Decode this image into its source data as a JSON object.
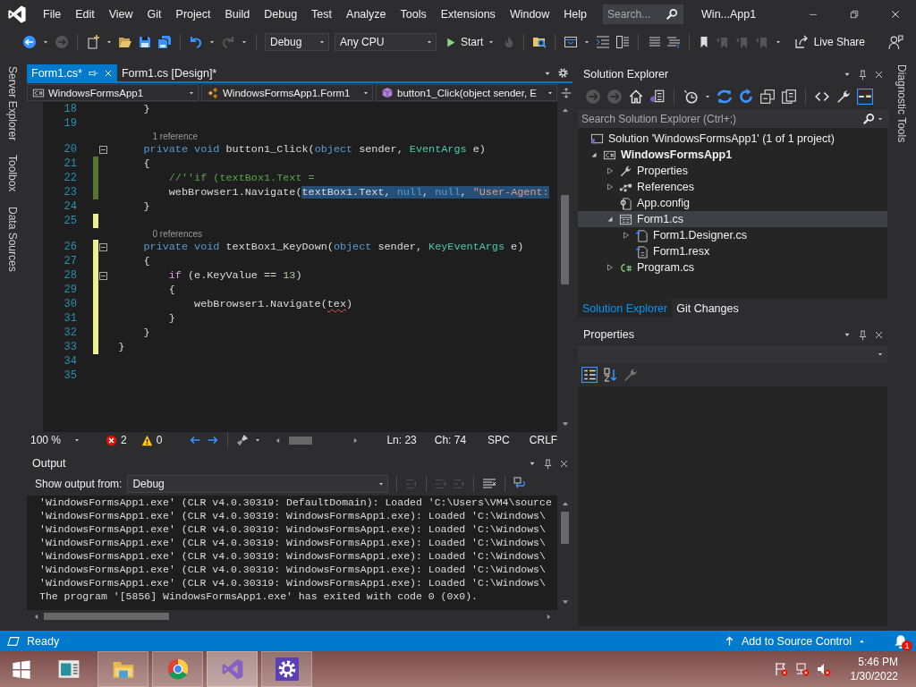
{
  "title_bar": {
    "menus": [
      "File",
      "Edit",
      "View",
      "Git",
      "Project",
      "Build",
      "Debug",
      "Test",
      "Analyze",
      "Tools",
      "Extensions",
      "Window",
      "Help"
    ],
    "search": {
      "placeholder": "Search..."
    },
    "title": "Win...App1"
  },
  "toolbar": {
    "configuration": "Debug",
    "platform": "Any CPU",
    "start": "Start",
    "live_share": "Live Share"
  },
  "left_tool_tabs": [
    "Server Explorer",
    "Toolbox",
    "Data Sources"
  ],
  "editor": {
    "tabs": [
      {
        "label": "Form1.cs*",
        "selected": true
      },
      {
        "label": "Form1.cs [Design]*",
        "selected": false
      }
    ],
    "nav": [
      {
        "kind": "project",
        "label": "WindowsFormsApp1"
      },
      {
        "kind": "class",
        "label": "WindowsFormsApp1.Form1"
      },
      {
        "kind": "method",
        "label": "button1_Click(object sender, E"
      }
    ],
    "lines": [
      {
        "number": "18",
        "changed": false,
        "tokens": [
          {
            "kind": "plain",
            "text": "      }"
          }
        ]
      },
      {
        "number": "19",
        "changed": false
      },
      {
        "number": "20",
        "changed": false,
        "lens": "1 reference",
        "fold": true,
        "tokens": [
          {
            "kind": "keyword",
            "text": "      private"
          },
          {
            "kind": "keyword",
            "text": " void"
          },
          {
            "kind": "plain",
            "text": " button1_Click("
          },
          {
            "kind": "keyword",
            "text": "object"
          },
          {
            "kind": "plain",
            "text": " sender, "
          },
          {
            "kind": "type",
            "text": "EventArgs"
          },
          {
            "kind": "plain",
            "text": " e)"
          }
        ]
      },
      {
        "number": "21",
        "changed": true,
        "saved": true,
        "tokens": [
          {
            "kind": "plain",
            "text": "      {"
          }
        ]
      },
      {
        "number": "22",
        "changed": true,
        "saved": true,
        "tokens": [
          {
            "kind": "comment",
            "text": "          //''if (textBox1.Text ="
          }
        ]
      },
      {
        "number": "23",
        "changed": true,
        "saved": true,
        "tokens": [
          {
            "kind": "plain",
            "text": "          webBrowser1.Navigate("
          },
          {
            "kind": "plain",
            "text": "textBox1.Text, ",
            "selected": true
          },
          {
            "kind": "keyword",
            "text": "null",
            "selected": true
          },
          {
            "kind": "plain",
            "text": ", ",
            "selected": true
          },
          {
            "kind": "keyword",
            "text": "null",
            "selected": true
          },
          {
            "kind": "plain",
            "text": ", ",
            "selected": true
          },
          {
            "kind": "string",
            "text": "\"User-Agent:",
            "selected": true
          }
        ]
      },
      {
        "number": "24",
        "changed": false,
        "tokens": [
          {
            "kind": "plain",
            "text": "      }"
          }
        ]
      },
      {
        "number": "25",
        "changed": true,
        "saved": false
      },
      {
        "number": "26",
        "changed": true,
        "saved": false,
        "lens": "0 references",
        "fold": true,
        "tokens": [
          {
            "kind": "keyword",
            "text": "      private"
          },
          {
            "kind": "keyword",
            "text": " void"
          },
          {
            "kind": "plain",
            "text": " textBox1_KeyDown("
          },
          {
            "kind": "keyword",
            "text": "object"
          },
          {
            "kind": "plain",
            "text": " sender, "
          },
          {
            "kind": "type",
            "text": "KeyEventArgs"
          },
          {
            "kind": "plain",
            "text": " e)"
          }
        ]
      },
      {
        "number": "27",
        "changed": true,
        "saved": false,
        "tokens": [
          {
            "kind": "plain",
            "text": "      {"
          }
        ]
      },
      {
        "number": "28",
        "changed": true,
        "saved": false,
        "fold": true,
        "tokens": [
          {
            "kind": "control",
            "text": "          if"
          },
          {
            "kind": "plain",
            "text": " (e.KeyValue == "
          },
          {
            "kind": "number",
            "text": "13"
          },
          {
            "kind": "plain",
            "text": ")"
          }
        ]
      },
      {
        "number": "29",
        "changed": true,
        "saved": false,
        "tokens": [
          {
            "kind": "plain",
            "text": "          {"
          }
        ]
      },
      {
        "number": "30",
        "changed": true,
        "saved": false,
        "tokens": [
          {
            "kind": "plain",
            "text": "              webBrowser1.Navigate("
          },
          {
            "kind": "plain",
            "text": "tex",
            "error": true
          },
          {
            "kind": "plain",
            "text": ")"
          }
        ]
      },
      {
        "number": "31",
        "changed": true,
        "saved": false,
        "tokens": [
          {
            "kind": "plain",
            "text": "          }"
          }
        ]
      },
      {
        "number": "32",
        "changed": true,
        "saved": false,
        "tokens": [
          {
            "kind": "plain",
            "text": "      }"
          }
        ]
      },
      {
        "number": "33",
        "changed": true,
        "saved": false,
        "tokens": [
          {
            "kind": "plain",
            "text": "  }"
          }
        ]
      },
      {
        "number": "34",
        "changed": false
      },
      {
        "number": "35",
        "changed": false
      }
    ],
    "status": {
      "zoom": "100 %",
      "errors": "2",
      "warnings": "0",
      "line": "Ln: 23",
      "column": "Ch: 74",
      "whitespace": "SPC",
      "line_ending": "CRLF"
    }
  },
  "output": {
    "title": "Output",
    "source_label": "Show output from:",
    "source": "Debug",
    "lines": [
      "'WindowsFormsApp1.exe' (CLR v4.0.30319: DefaultDomain): Loaded 'C:\\Users\\VM4\\source",
      "'WindowsFormsApp1.exe' (CLR v4.0.30319: WindowsFormsApp1.exe): Loaded 'C:\\Windows\\",
      "'WindowsFormsApp1.exe' (CLR v4.0.30319: WindowsFormsApp1.exe): Loaded 'C:\\Windows\\",
      "'WindowsFormsApp1.exe' (CLR v4.0.30319: WindowsFormsApp1.exe): Loaded 'C:\\Windows\\",
      "'WindowsFormsApp1.exe' (CLR v4.0.30319: WindowsFormsApp1.exe): Loaded 'C:\\Windows\\",
      "'WindowsFormsApp1.exe' (CLR v4.0.30319: WindowsFormsApp1.exe): Loaded 'C:\\Windows\\",
      "'WindowsFormsApp1.exe' (CLR v4.0.30319: WindowsFormsApp1.exe): Loaded 'C:\\Windows\\",
      "The program '[5856] WindowsFormsApp1.exe' has exited with code 0 (0x0)."
    ]
  },
  "solution_explorer": {
    "title": "Solution Explorer",
    "search": {
      "placeholder": "Search Solution Explorer (Ctrl+;)"
    },
    "tree": [
      {
        "label": "Solution 'WindowsFormsApp1' (1 of 1 project)",
        "kind": "solution",
        "selected": false,
        "children": [
          {
            "label": "WindowsFormsApp1",
            "kind": "project",
            "expanded": true,
            "selected": false,
            "children": [
              {
                "label": "Properties",
                "kind": "properties",
                "expanded": false,
                "selected": false
              },
              {
                "label": "References",
                "kind": "references",
                "expanded": false,
                "selected": false
              },
              {
                "label": "App.config",
                "kind": "config",
                "selected": false
              },
              {
                "label": "Form1.cs",
                "kind": "form",
                "expanded": true,
                "selected": true,
                "children": [
                  {
                    "label": "Form1.Designer.cs",
                    "kind": "designer",
                    "expanded": false,
                    "selected": false
                  },
                  {
                    "label": "Form1.resx",
                    "kind": "resource",
                    "selected": false
                  }
                ]
              },
              {
                "label": "Program.cs",
                "kind": "csharp",
                "expanded": false,
                "selected": false
              }
            ]
          }
        ]
      }
    ],
    "tabs": [
      {
        "label": "Solution Explorer",
        "selected": true
      },
      {
        "label": "Git Changes",
        "selected": false
      }
    ]
  },
  "properties": {
    "title": "Properties"
  },
  "right_tool_tabs": [
    "Diagnostic Tools"
  ],
  "status_bar": {
    "state": "Ready",
    "source_control": "Add to Source Control",
    "notifications": "1"
  },
  "taskbar": {
    "apps": [
      {
        "kind": "document",
        "running": false,
        "selected": false
      },
      {
        "kind": "folder",
        "running": true,
        "selected": false
      },
      {
        "kind": "browser",
        "running": true,
        "selected": false
      },
      {
        "kind": "ide",
        "running": true,
        "selected": true
      },
      {
        "kind": "settings",
        "running": true,
        "selected": false
      }
    ],
    "time": "5:46 PM",
    "date": "1/30/2022"
  }
}
